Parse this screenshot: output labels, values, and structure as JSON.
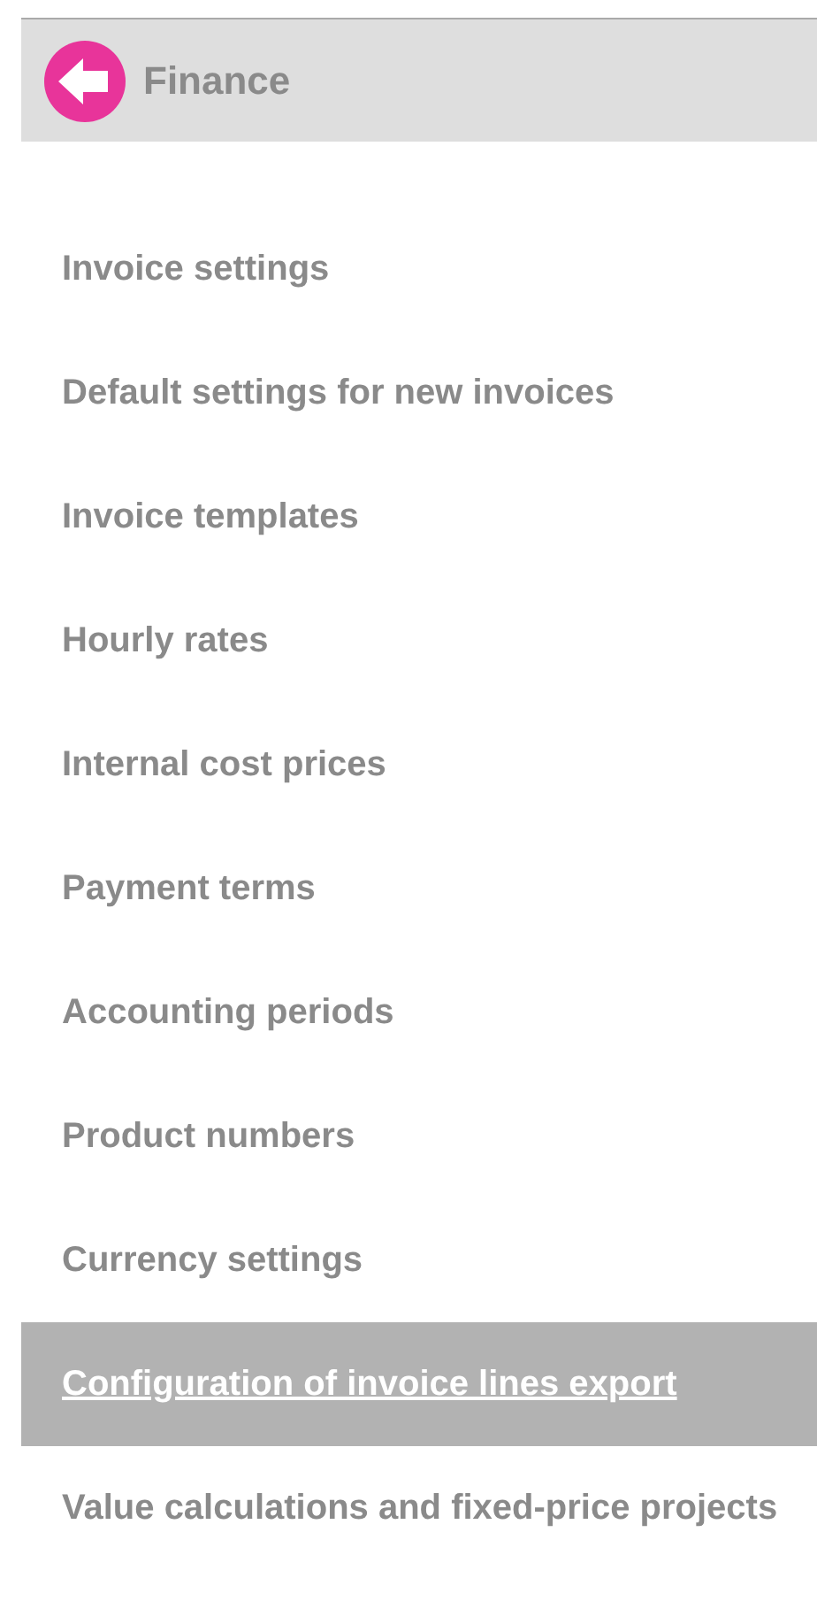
{
  "header": {
    "title": "Finance"
  },
  "menu": [
    {
      "label": "Invoice settings",
      "selected": false
    },
    {
      "label": "Default settings for new invoices",
      "selected": false
    },
    {
      "label": "Invoice templates",
      "selected": false
    },
    {
      "label": "Hourly rates",
      "selected": false
    },
    {
      "label": "Internal cost prices",
      "selected": false
    },
    {
      "label": "Payment terms",
      "selected": false
    },
    {
      "label": "Accounting periods",
      "selected": false
    },
    {
      "label": "Product numbers",
      "selected": false
    },
    {
      "label": "Currency settings",
      "selected": false
    },
    {
      "label": "Configuration of invoice lines export",
      "selected": true
    },
    {
      "label": "Value calculations and fixed-price projects",
      "selected": false
    }
  ]
}
